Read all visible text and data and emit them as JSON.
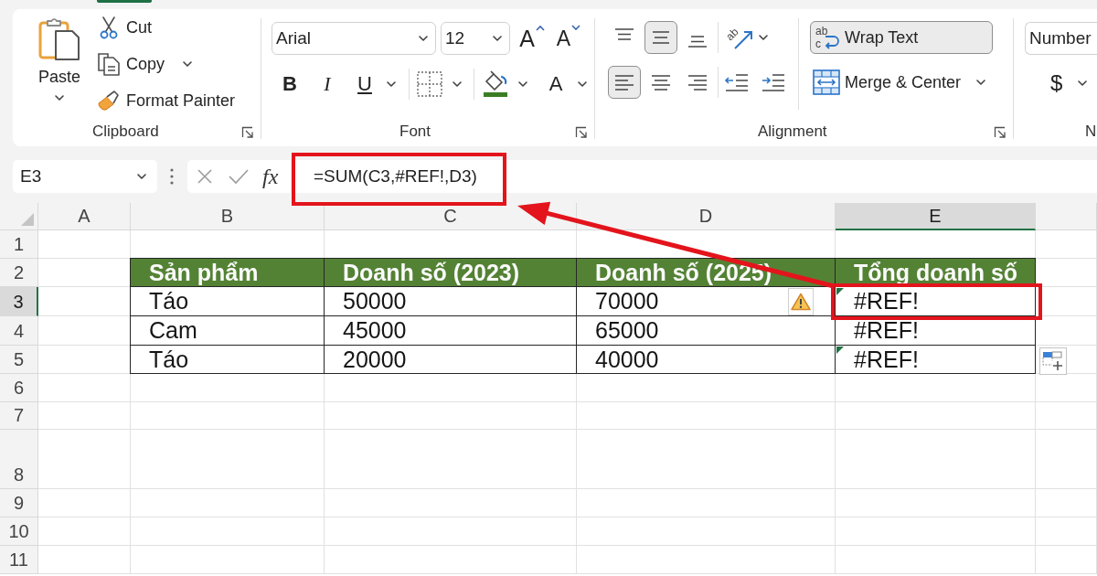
{
  "ribbon": {
    "active_tab_marker": true,
    "clipboard": {
      "label": "Clipboard",
      "paste": {
        "label": "Paste"
      },
      "commands": [
        {
          "kind": "cut",
          "label": "Cut",
          "dropdown": false
        },
        {
          "kind": "copy",
          "label": "Copy",
          "dropdown": true
        },
        {
          "kind": "format_painter",
          "label": "Format Painter",
          "dropdown": false
        }
      ]
    },
    "font": {
      "label": "Font",
      "font_name": "Arial",
      "font_size": "12",
      "size_buttons": [
        {
          "kind": "grow",
          "glyph": "A"
        },
        {
          "kind": "shrink",
          "glyph": "A"
        }
      ],
      "style_buttons": [
        {
          "kind": "bold",
          "glyph": "B",
          "dropdown": false
        },
        {
          "kind": "italic",
          "glyph": "I",
          "dropdown": false
        },
        {
          "kind": "underline",
          "glyph": "U",
          "dropdown": true
        }
      ],
      "font_color": {
        "glyph": "A"
      }
    },
    "alignment": {
      "label": "Alignment",
      "vertical": [
        {
          "kind": "top",
          "selected": false
        },
        {
          "kind": "middle",
          "selected": true
        },
        {
          "kind": "bottom",
          "selected": false
        }
      ],
      "horizontal": [
        {
          "kind": "left",
          "selected": true
        },
        {
          "kind": "center",
          "selected": false
        },
        {
          "kind": "right",
          "selected": false
        }
      ],
      "orientation": {
        "glyph": "ab"
      },
      "wrap_text": {
        "label": "Wrap Text",
        "glyph_top": "ab",
        "glyph_bottom": "c",
        "on": true
      },
      "merge": {
        "label": "Merge & Center"
      }
    },
    "number": {
      "label": "N",
      "format": "Number",
      "currency": "$"
    }
  },
  "formula_bar": {
    "name_box": "E3",
    "function_label": "fx",
    "formula": "=SUM(C3,#REF!,D3)"
  },
  "sheet": {
    "columns": [
      {
        "label": "A",
        "selected": false
      },
      {
        "label": "B",
        "selected": false
      },
      {
        "label": "C",
        "selected": false
      },
      {
        "label": "D",
        "selected": false
      },
      {
        "label": "E",
        "selected": true
      }
    ],
    "rows": [
      {
        "label": "1",
        "selected": false
      },
      {
        "label": "2",
        "selected": false
      },
      {
        "label": "3",
        "selected": true
      },
      {
        "label": "4",
        "selected": false
      },
      {
        "label": "5",
        "selected": false
      },
      {
        "label": "6",
        "selected": false
      },
      {
        "label": "7",
        "selected": false
      },
      {
        "label": "8",
        "selected": false
      },
      {
        "label": "9",
        "selected": false
      },
      {
        "label": "10",
        "selected": false
      },
      {
        "label": "11",
        "selected": false
      }
    ],
    "table": {
      "header": [
        "Sản phẩm",
        "Doanh số (2023)",
        "Doanh số (2025)",
        "Tổng doanh số"
      ],
      "rows": [
        {
          "cells": [
            "Táo",
            "50000",
            "70000",
            "#REF!"
          ],
          "error_flag": true,
          "warning_button": true
        },
        {
          "cells": [
            "Cam",
            "45000",
            "65000",
            "#REF!"
          ],
          "error_flag": false,
          "warning_button": false
        },
        {
          "cells": [
            "Táo",
            "20000",
            "40000",
            "#REF!"
          ],
          "error_flag": true,
          "warning_button": false
        }
      ]
    }
  },
  "annotations": {
    "formula_frame": true,
    "cell_frame": true,
    "arrow": true
  }
}
